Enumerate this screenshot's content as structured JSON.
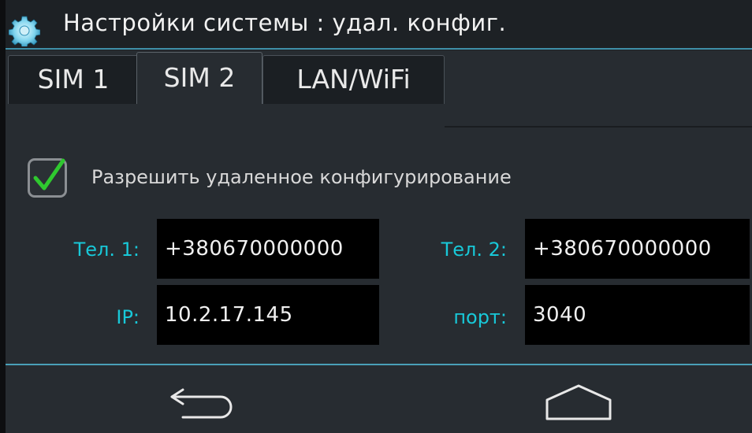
{
  "header": {
    "icon": "gear-icon",
    "title": "Настройки системы : удал. конфиг."
  },
  "tabs": [
    {
      "label": "SIM 1",
      "active": false
    },
    {
      "label": "SIM 2",
      "active": true
    },
    {
      "label": "LAN/WiFi",
      "active": false
    }
  ],
  "remote_config": {
    "checked": true,
    "label": "Разрешить удаленное конфигурирование"
  },
  "fields": {
    "tel1": {
      "label": "Тел. 1:",
      "value": "+380670000000"
    },
    "tel2": {
      "label": "Тел. 2:",
      "value": "+380670000000"
    },
    "ip": {
      "label": "IP:",
      "value": "10.2.17.145"
    },
    "port": {
      "label": "порт:",
      "value": "3040"
    }
  },
  "nav": {
    "back_icon": "back-arrow-icon",
    "home_icon": "home-icon"
  },
  "colors": {
    "accent": "#18c8d8",
    "background": "#272c31",
    "field_bg": "#000000",
    "check": "#2fc82f"
  }
}
